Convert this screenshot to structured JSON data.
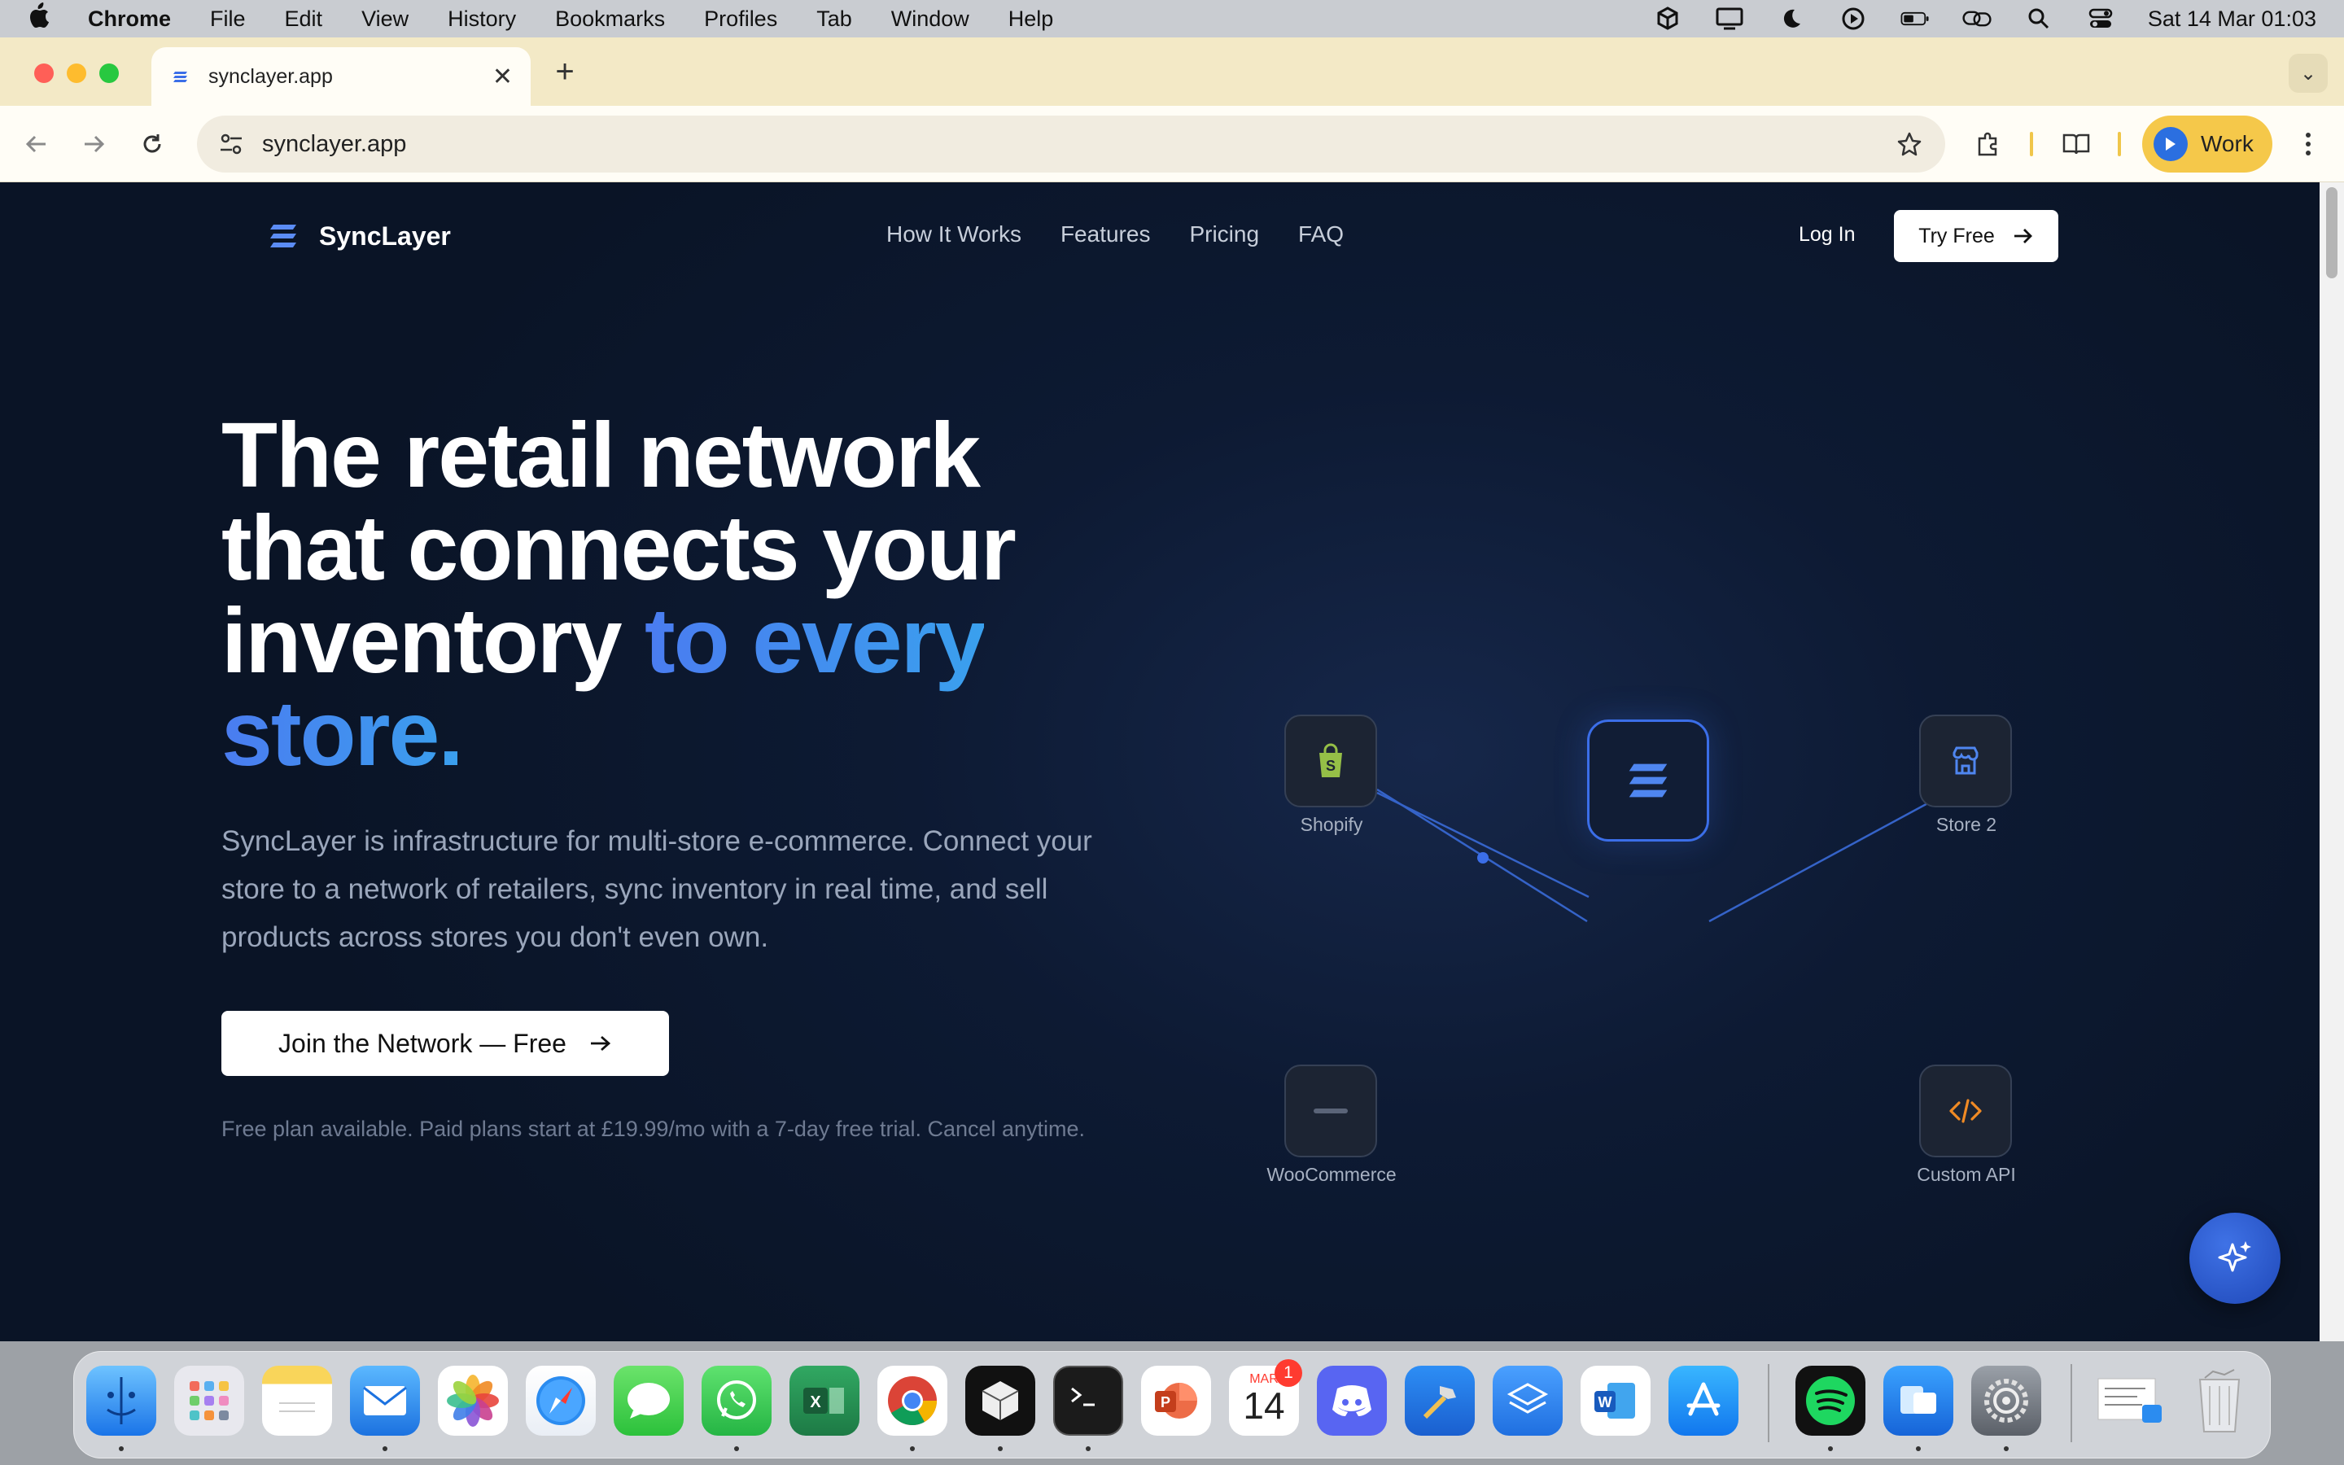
{
  "menubar": {
    "app": "Chrome",
    "items": [
      "File",
      "Edit",
      "View",
      "History",
      "Bookmarks",
      "Profiles",
      "Tab",
      "Window",
      "Help"
    ],
    "clock": "Sat 14 Mar  01:03"
  },
  "browser": {
    "tab_title": "synclayer.app",
    "url": "synclayer.app",
    "profile_label": "Work"
  },
  "site": {
    "brand": "SyncLayer",
    "nav": [
      "How It Works",
      "Features",
      "Pricing",
      "FAQ"
    ],
    "login": "Log In",
    "try_free": "Try Free",
    "hero": {
      "line1": "The retail network",
      "line2": "that connects your",
      "line3_plain": "inventory",
      "line3_accent": "to every",
      "line4_accent": "store.",
      "subtitle": "SyncLayer is infrastructure for multi-store e-commerce. Connect your store to a network of retailers, sync inventory in real time, and sell products across stores you don't even own.",
      "cta": "Join the Network — Free",
      "fineprint": "Free plan available. Paid plans start at £19.99/mo with a 7-day free trial. Cancel anytime."
    },
    "diagram": {
      "nodes": [
        "Shopify",
        "Store 2",
        "WooCommerce",
        "Custom API"
      ]
    }
  },
  "dock": {
    "calendar_month": "MAR",
    "calendar_day": "14",
    "calendar_badge": "1"
  },
  "colors": {
    "accent": "#3b6ee8",
    "page_bg": "#0d1a33",
    "shopify_green": "#95bf47",
    "api_orange": "#f08a24"
  }
}
